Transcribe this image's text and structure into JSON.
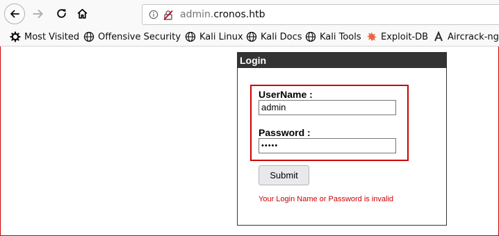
{
  "browser": {
    "url_prefix": "admin.",
    "url_host": "cronos.htb",
    "bookmarks": [
      {
        "label": "Most Visited",
        "icon": "gear-icon"
      },
      {
        "label": "Offensive Security",
        "icon": "globe-icon"
      },
      {
        "label": "Kali Linux",
        "icon": "globe-icon"
      },
      {
        "label": "Kali Docs",
        "icon": "globe-icon"
      },
      {
        "label": "Kali Tools",
        "icon": "globe-icon"
      },
      {
        "label": "Exploit-DB",
        "icon": "exploitdb-icon"
      },
      {
        "label": "Aircrack-ng",
        "icon": "aircrack-icon"
      }
    ]
  },
  "login": {
    "title": "Login",
    "username_label": "UserName :",
    "username_value": "admin",
    "password_label": "Password :",
    "password_value": "•••••",
    "submit_label": "Submit",
    "error_message": "Your Login Name or Password is invalid"
  },
  "colors": {
    "header_bg": "#333333",
    "error": "#cc0000",
    "highlight": "#cc0000"
  }
}
